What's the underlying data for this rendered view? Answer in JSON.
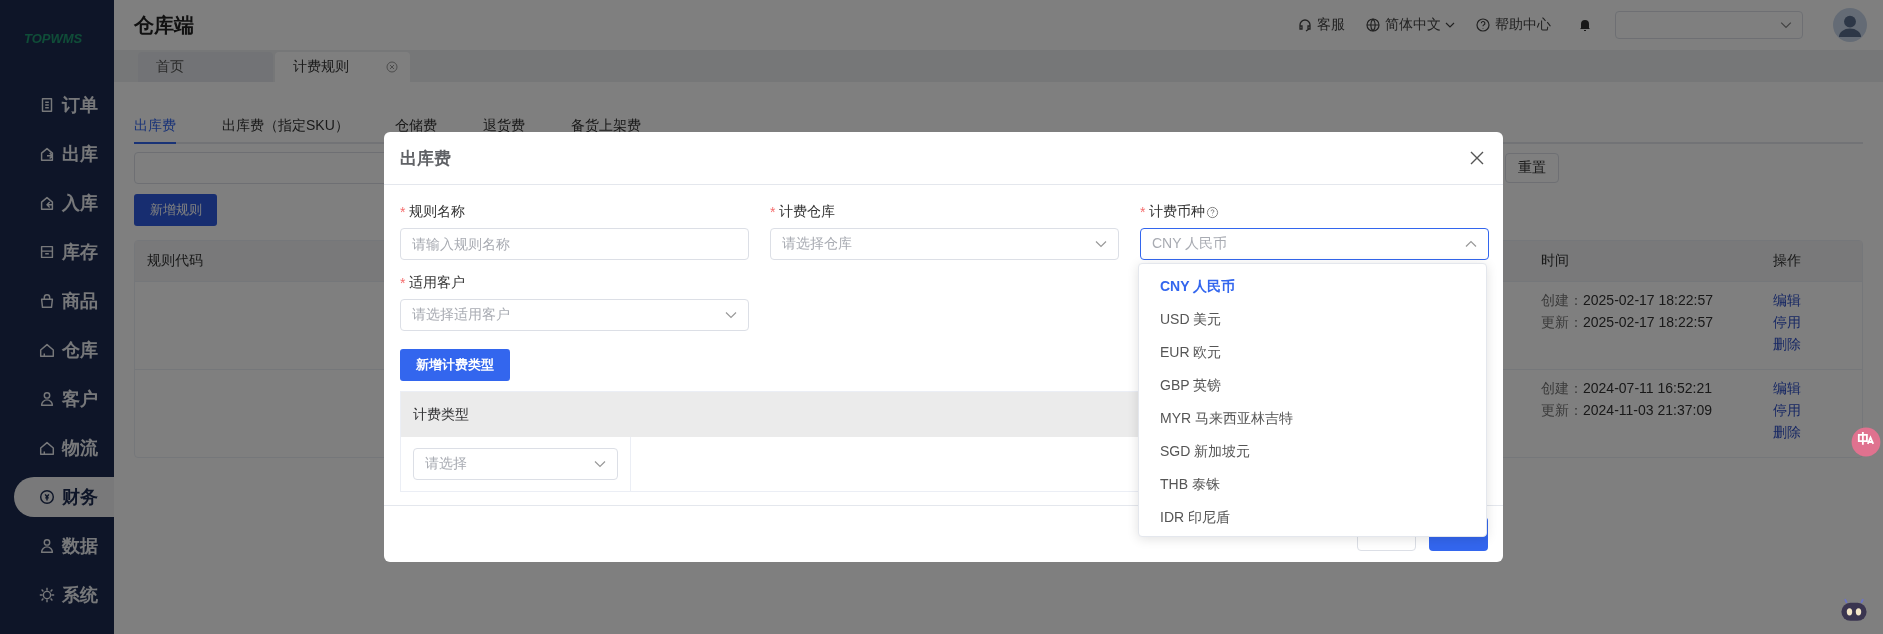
{
  "sidebar": {
    "logo": "TOPWMS",
    "items": [
      {
        "label": "订单",
        "selected": false
      },
      {
        "label": "出库",
        "selected": false
      },
      {
        "label": "入库",
        "selected": false
      },
      {
        "label": "库存",
        "selected": false
      },
      {
        "label": "商品",
        "selected": false
      },
      {
        "label": "仓库",
        "selected": false
      },
      {
        "label": "客户",
        "selected": false
      },
      {
        "label": "物流",
        "selected": false
      },
      {
        "label": "财务",
        "selected": true
      },
      {
        "label": "数据",
        "selected": false
      },
      {
        "label": "系统",
        "selected": false
      }
    ]
  },
  "header": {
    "title": "仓库端",
    "links": [
      {
        "label": "客服",
        "dropdown": false
      },
      {
        "label": "简体中文",
        "dropdown": true
      },
      {
        "label": "帮助中心",
        "dropdown": false
      }
    ]
  },
  "page_tabs": [
    {
      "label": "首页",
      "selected": false,
      "closable": false
    },
    {
      "label": "计费规则",
      "selected": true,
      "closable": true
    }
  ],
  "fee_tabs": [
    {
      "label": "出库费",
      "selected": true
    },
    {
      "label": "出库费（指定SKU）",
      "selected": false
    },
    {
      "label": "仓储费",
      "selected": false
    },
    {
      "label": "退货费",
      "selected": false
    },
    {
      "label": "备货上架费",
      "selected": false
    }
  ],
  "filter": {
    "reset_button": "重置"
  },
  "add_rule_button": "新增规则",
  "table": {
    "columns": [
      "规则代码",
      "时间",
      "操作"
    ],
    "rows": [
      {
        "times": [
          {
            "label": "创建：",
            "value": "2025-02-17 18:22:57"
          },
          {
            "label": "更新：",
            "value": "2025-02-17 18:22:57"
          }
        ],
        "actions": [
          "编辑",
          "停用",
          "删除"
        ]
      },
      {
        "times": [
          {
            "label": "创建：",
            "value": "2024-07-11 16:52:21"
          },
          {
            "label": "更新：",
            "value": "2024-11-03 21:37:09"
          }
        ],
        "actions": [
          "编辑",
          "停用",
          "删除"
        ]
      }
    ]
  },
  "modal": {
    "title": "出库费",
    "fields": [
      {
        "label": "规则名称",
        "required_mark": "*",
        "kind": "input",
        "placeholder": "请输入规则名称",
        "help": false
      },
      {
        "label": "计费仓库",
        "required_mark": "*",
        "kind": "select",
        "placeholder": "请选择仓库",
        "expanded": false,
        "help": false
      },
      {
        "label": "计费币种",
        "required_mark": "*",
        "kind": "select",
        "placeholder": "CNY 人民币",
        "expanded": true,
        "help": true
      },
      {
        "label": "适用客户",
        "required_mark": "*",
        "kind": "select",
        "placeholder": "请选择适用客户",
        "expanded": false,
        "help": false
      }
    ],
    "add_type_button": "新增计费类型",
    "type_table": {
      "columns": [
        "计费类型"
      ],
      "rows": [
        {
          "placeholder": "请选择"
        }
      ]
    },
    "currency_options": [
      {
        "label": "CNY 人民币",
        "selected": true
      },
      {
        "label": "USD 美元",
        "selected": false
      },
      {
        "label": "EUR 欧元",
        "selected": false
      },
      {
        "label": "GBP 英镑",
        "selected": false
      },
      {
        "label": "MYR 马来西亚林吉特",
        "selected": false
      },
      {
        "label": "SGD 新加坡元",
        "selected": false
      },
      {
        "label": "THB 泰铢",
        "selected": false
      },
      {
        "label": "IDR 印尼盾",
        "selected": false
      }
    ]
  }
}
